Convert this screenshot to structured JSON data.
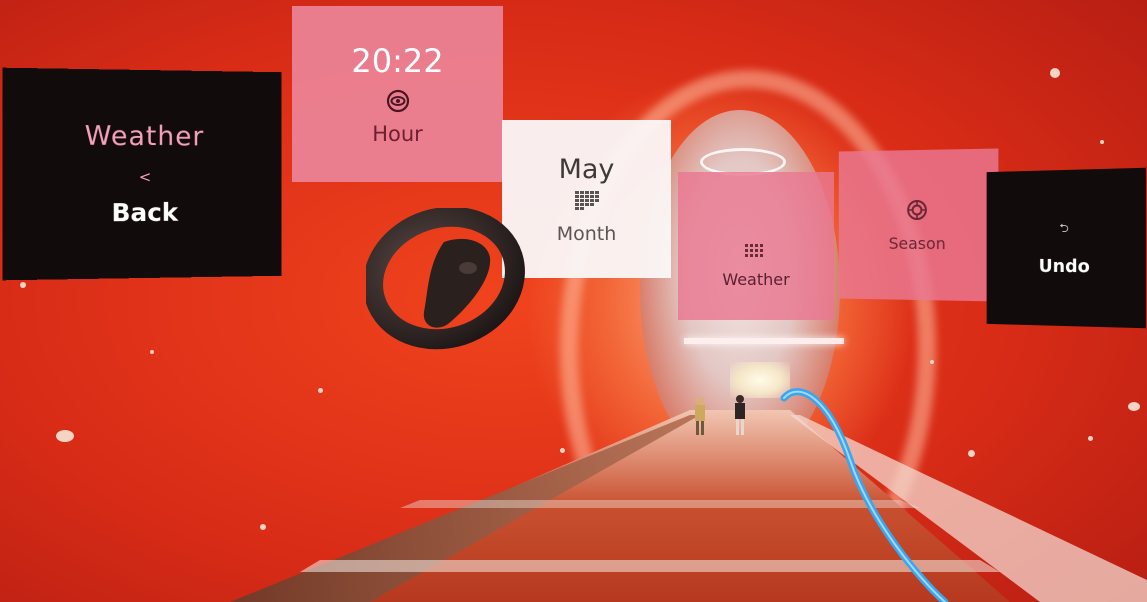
{
  "scene": {
    "name": "vr-tunnel-environment"
  },
  "panels": {
    "back": {
      "title": "Weather",
      "chevron": "<",
      "label": "Back"
    },
    "hour": {
      "time": "20:22",
      "icon": "eye-icon",
      "label": "Hour"
    },
    "month": {
      "value": "May",
      "icon": "calendar-grid-icon",
      "label": "Month"
    },
    "weather": {
      "icon": "weather-grid-icon",
      "label": "Weather"
    },
    "season": {
      "icon": "flower-icon",
      "label": "Season"
    },
    "undo": {
      "icon": "undo-arrow-icon",
      "glyph": "⮌",
      "label": "Undo"
    }
  },
  "colors": {
    "tunnel_red": "#d92c17",
    "panel_dark": "#120b0c",
    "panel_pink": "#ec8498",
    "panel_white": "#faf6f6",
    "pointer_ray": "#3aa6ee"
  }
}
